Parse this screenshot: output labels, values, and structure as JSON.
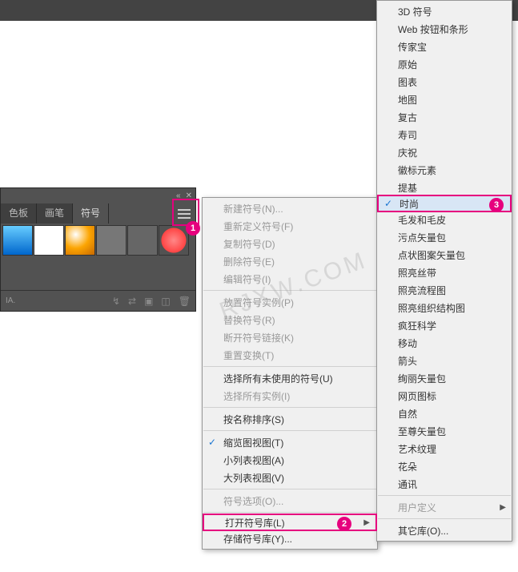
{
  "panel": {
    "tabs": [
      "色板",
      "画笔",
      "符号"
    ],
    "active_tab_index": 2,
    "symbols": [
      "gradient",
      "ink-dots",
      "orange-ball",
      "crop-marks",
      "gear",
      "flower"
    ],
    "footer_label": "IA."
  },
  "menu1": {
    "groups": [
      [
        {
          "label": "新建符号(N)...",
          "disabled": true
        },
        {
          "label": "重新定义符号(F)",
          "disabled": true
        },
        {
          "label": "复制符号(D)",
          "disabled": true
        },
        {
          "label": "删除符号(E)",
          "disabled": true
        },
        {
          "label": "编辑符号(I)",
          "disabled": true
        }
      ],
      [
        {
          "label": "放置符号实例(P)",
          "disabled": true
        },
        {
          "label": "替换符号(R)",
          "disabled": true
        },
        {
          "label": "断开符号链接(K)",
          "disabled": true
        },
        {
          "label": "重置变换(T)",
          "disabled": true
        }
      ],
      [
        {
          "label": "选择所有未使用的符号(U)"
        },
        {
          "label": "选择所有实例(I)",
          "disabled": true
        }
      ],
      [
        {
          "label": "按名称排序(S)"
        }
      ],
      [
        {
          "label": "缩览图视图(T)",
          "checked": true
        },
        {
          "label": "小列表视图(A)"
        },
        {
          "label": "大列表视图(V)"
        }
      ],
      [
        {
          "label": "符号选项(O)...",
          "disabled": true
        }
      ],
      [
        {
          "label": "打开符号库(L)",
          "arrow": true,
          "highlight": true,
          "badge": 2
        },
        {
          "label": "存储符号库(Y)..."
        }
      ]
    ]
  },
  "menu2": {
    "items": [
      {
        "label": "3D 符号"
      },
      {
        "label": "Web 按钮和条形"
      },
      {
        "label": "传家宝"
      },
      {
        "label": "原始"
      },
      {
        "label": "图表"
      },
      {
        "label": "地图"
      },
      {
        "label": "复古"
      },
      {
        "label": "寿司"
      },
      {
        "label": "庆祝"
      },
      {
        "label": "徽标元素"
      },
      {
        "label": "提基"
      },
      {
        "label": "时尚",
        "selected": true,
        "checked": true,
        "highlight": true,
        "badge": 3
      },
      {
        "label": "毛发和毛皮"
      },
      {
        "label": "污点矢量包"
      },
      {
        "label": "点状图案矢量包"
      },
      {
        "label": "照亮丝带"
      },
      {
        "label": "照亮流程图"
      },
      {
        "label": "照亮组织结构图"
      },
      {
        "label": "疯狂科学"
      },
      {
        "label": "移动"
      },
      {
        "label": "箭头"
      },
      {
        "label": "绚丽矢量包"
      },
      {
        "label": "网页图标"
      },
      {
        "label": "自然"
      },
      {
        "label": "至尊矢量包"
      },
      {
        "label": "艺术纹理"
      },
      {
        "label": "花朵"
      },
      {
        "label": "通讯"
      }
    ],
    "sep_after_index": 27,
    "tail": [
      {
        "label": "用户定义",
        "arrow": true,
        "disabled": true
      }
    ],
    "sep_after_tail": true,
    "tail2": [
      {
        "label": "其它库(O)..."
      }
    ]
  },
  "badges": {
    "b1": "1"
  },
  "watermark": "RJXW.COM"
}
